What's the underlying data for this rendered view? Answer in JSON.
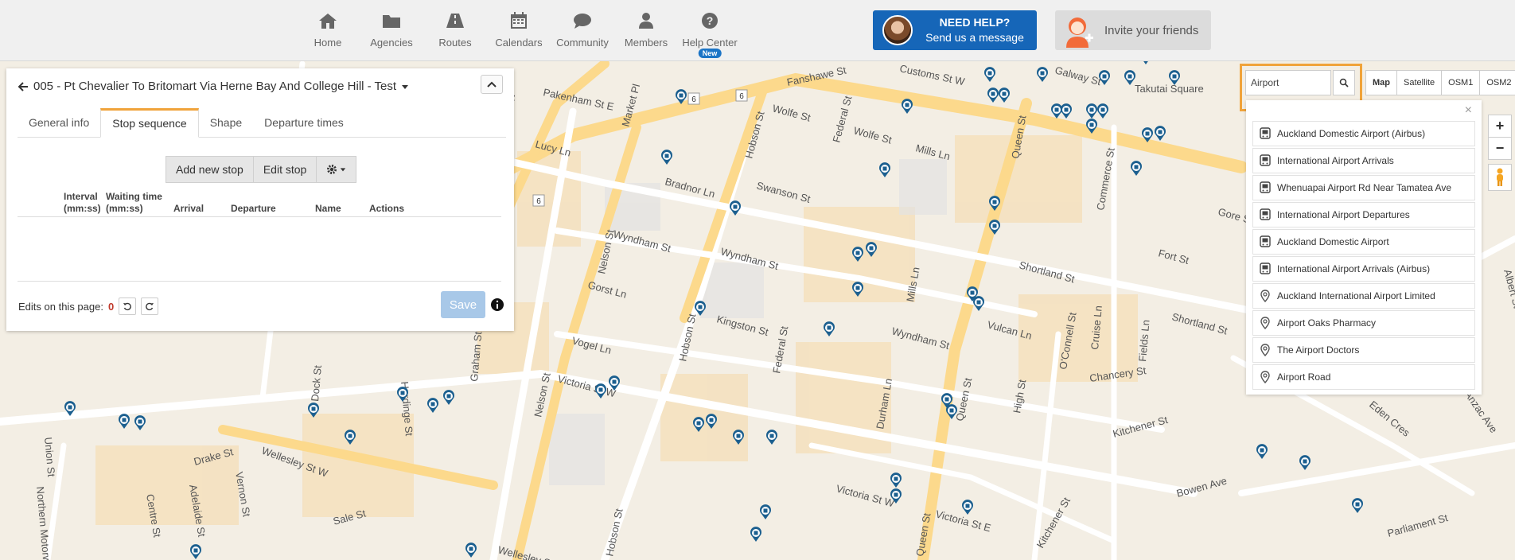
{
  "nav": {
    "items": [
      {
        "label": "Home",
        "icon": "home-icon"
      },
      {
        "label": "Agencies",
        "icon": "folder-icon"
      },
      {
        "label": "Routes",
        "icon": "road-icon"
      },
      {
        "label": "Calendars",
        "icon": "calendar-icon"
      },
      {
        "label": "Community",
        "icon": "chat-bubble-icon"
      },
      {
        "label": "Members",
        "icon": "user-icon"
      },
      {
        "label": "Help Center",
        "icon": "question-circle-icon",
        "badge": "New"
      }
    ]
  },
  "help": {
    "title": "NEED HELP?",
    "subtitle": "Send us a message"
  },
  "invite": {
    "label": "Invite your friends"
  },
  "panel": {
    "title": "005 - Pt Chevalier To Britomart Via Herne Bay And College Hill - Test",
    "tabs": [
      "General info",
      "Stop sequence",
      "Shape",
      "Departure times"
    ],
    "active_tab": "Stop sequence",
    "buttons": {
      "add": "Add new stop",
      "edit": "Edit stop"
    },
    "columns": [
      {
        "line1": "Interval",
        "line2": "(mm:ss)"
      },
      {
        "line1": "Waiting time",
        "line2": "(mm:ss)"
      },
      {
        "line1": "",
        "line2": "Arrival"
      },
      {
        "line1": "",
        "line2": "Departure"
      },
      {
        "line1": "",
        "line2": "Name"
      },
      {
        "line1": "",
        "line2": "Actions"
      }
    ],
    "edits_label": "Edits on this page:",
    "edits_count": "0",
    "save_label": "Save"
  },
  "map": {
    "search_value": "Airport",
    "layers": [
      "Map",
      "Satellite",
      "OSM1",
      "OSM2"
    ],
    "active_layer": "Map",
    "zoom_in": "+",
    "zoom_out": "−",
    "results_close": "×",
    "results": [
      {
        "label": "Auckland Domestic Airport (Airbus)",
        "kind": "bus-stop-icon"
      },
      {
        "label": "International Airport Arrivals",
        "kind": "bus-stop-icon"
      },
      {
        "label": "Whenuapai Airport Rd Near Tamatea Ave",
        "kind": "bus-stop-icon"
      },
      {
        "label": "International Airport Departures",
        "kind": "bus-stop-icon"
      },
      {
        "label": "Auckland Domestic Airport",
        "kind": "bus-stop-icon"
      },
      {
        "label": "International Airport Arrivals (Airbus)",
        "kind": "bus-stop-icon"
      },
      {
        "label": "Auckland International Airport Limited",
        "kind": "place-pin-icon"
      },
      {
        "label": "Airport Oaks Pharmacy",
        "kind": "place-pin-icon"
      },
      {
        "label": "The Airport Doctors",
        "kind": "place-pin-icon"
      },
      {
        "label": "Airport Road",
        "kind": "place-pin-icon"
      }
    ],
    "streets": [
      "Fanshawe St",
      "Customs St W",
      "Galway St",
      "Takutai Square",
      "Pakenham St E",
      "Market Pl",
      "Lucy Ln",
      "Customs St W",
      "Wolfe St",
      "Wolfe St",
      "Federal St",
      "Hobson St",
      "Mills Ln",
      "Queen St",
      "Commerce St",
      "Gore St",
      "Swanson St",
      "Bradnor Ln",
      "Nelson St",
      "Wyndham St",
      "Wyndham St",
      "Shortland St",
      "Fort St",
      "Gorst Ln",
      "Kingston St",
      "Mills Ln",
      "Wyndham St",
      "Vulcan Ln",
      "O'Connell St",
      "Fields Ln",
      "Cruise Ln",
      "Shortland St",
      "Vogel Ln",
      "Victoria St W",
      "Hobson St",
      "Nelson St",
      "Federal St",
      "Durham Ln",
      "High St",
      "Queen St",
      "Chancery St",
      "Hardinge St",
      "Graham St",
      "Dock St",
      "Wellesley St W",
      "Union St",
      "Drake St",
      "Northern Motorway",
      "Centre St",
      "Adelaide St",
      "Vernon St",
      "Sale St",
      "Victoria St W",
      "Victoria St E",
      "Kitchener St",
      "Bowen Ave",
      "Eden Cres",
      "Anzac Ave",
      "Parliament St",
      "Wellesley St",
      "Hobson St",
      "Queen St",
      "Kitchener St",
      "Albert St"
    ],
    "shield_a": "6",
    "shield_b": "6",
    "shield_c": "6"
  }
}
